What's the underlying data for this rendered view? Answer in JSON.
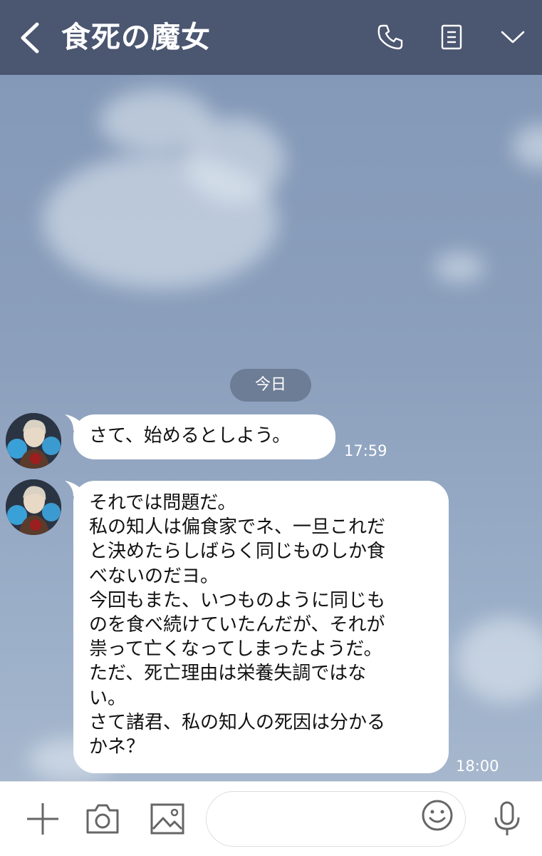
{
  "header": {
    "title": "食死の魔女",
    "back_icon": "chevron-left-icon",
    "call_icon": "phone-icon",
    "notes_icon": "notes-icon",
    "menu_icon": "chevron-down-icon",
    "background_color": "#4b5670"
  },
  "chat": {
    "date_separator": "今日",
    "messages": [
      {
        "sender_avatar": "character-avatar",
        "text": "さて、始めるとしよう。",
        "time": "17:59"
      },
      {
        "sender_avatar": "character-avatar",
        "text": "それでは問題だ。\n私の知人は偏食家でネ、一旦これだと決めたらしばらく同じものしか食べないのだヨ。\n今回もまた、いつものように同じものを食べ続けていたんだが、それが祟って亡くなってしまったようだ。\nただ、死亡理由は栄養失調ではない。\nさて諸君、私の知人の死因は分かるかネ？",
        "lines": [
          "それでは問題だ。",
          "私の知人は偏食家でネ、一旦これだ",
          "と決めたらしばらく同じものしか食",
          "べないのだヨ。",
          "今回もまた、いつものように同じも",
          "のを食べ続けていたんだが、それが",
          "祟って亡くなってしまったようだ。",
          "ただ、死亡理由は栄養失調ではな",
          "い。",
          "さて諸君、私の知人の死因は分かる",
          "かネ？"
        ],
        "time": "18:00"
      }
    ]
  },
  "input_bar": {
    "plus_icon": "plus-icon",
    "camera_icon": "camera-icon",
    "image_icon": "image-icon",
    "emoji_icon": "emoji-icon",
    "mic_icon": "microphone-icon",
    "message_value": ""
  }
}
